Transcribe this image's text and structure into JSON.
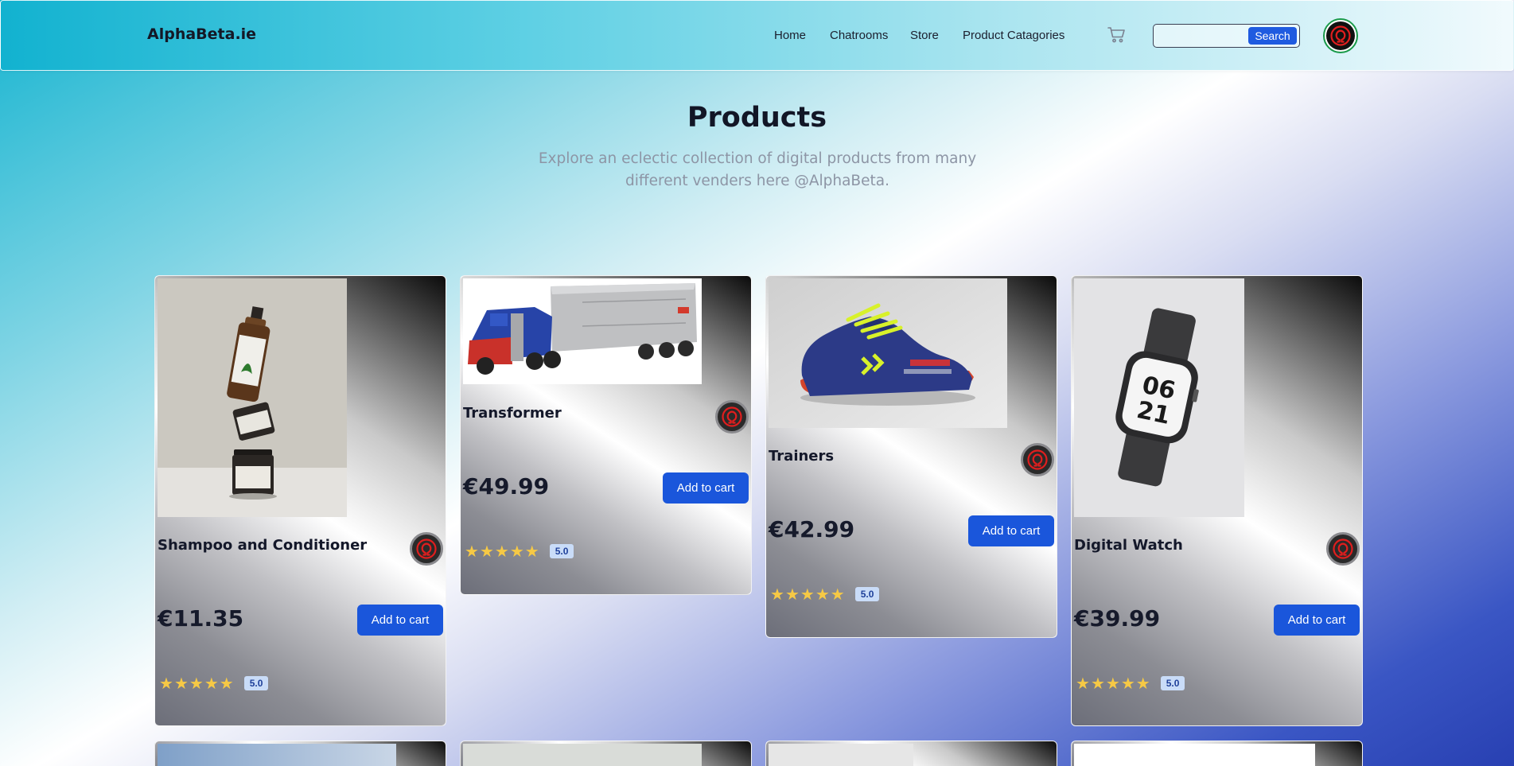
{
  "nav": {
    "brand": "AlphaBeta.ie",
    "links": [
      "Home",
      "Chatrooms",
      "Store",
      "Product Catagories"
    ],
    "search_placeholder": "",
    "search_button": "Search"
  },
  "header": {
    "title": "Products",
    "subtitle": "Explore an eclectic collection of digital products from many different venders here @AlphaBeta."
  },
  "products": [
    {
      "title": "Shampoo and Conditioner",
      "price": "€11.35",
      "button": "Add to cart",
      "stars": 5,
      "rating": "5.0",
      "image": "shampoo-bottles"
    },
    {
      "title": "Transformer",
      "price": "€49.99",
      "button": "Add to cart",
      "stars": 5,
      "rating": "5.0",
      "image": "toy-truck"
    },
    {
      "title": "Trainers",
      "price": "€42.99",
      "button": "Add to cart",
      "stars": 5,
      "rating": "5.0",
      "image": "sneaker"
    },
    {
      "title": "Digital Watch",
      "price": "€39.99",
      "button": "Add to cart",
      "stars": 5,
      "rating": "5.0",
      "image": "smartwatch"
    }
  ],
  "colors": {
    "accent": "#1a56db",
    "star": "#f6c945",
    "badge_bg": "#c9dcf8",
    "avatar_ring": "#1a9a4a",
    "logo_red": "#e01e1e"
  }
}
